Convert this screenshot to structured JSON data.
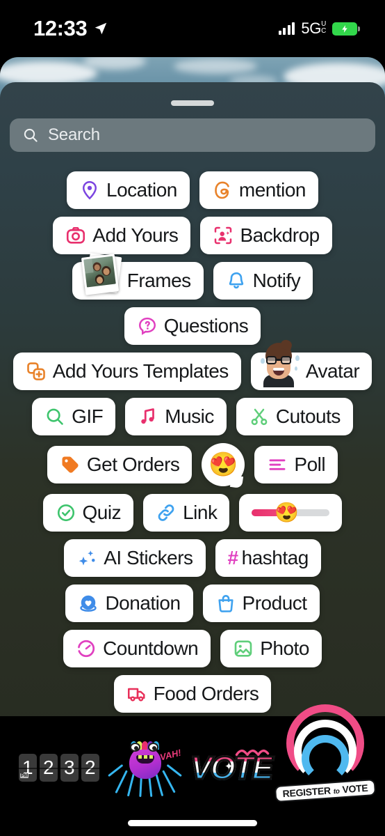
{
  "status_bar": {
    "time": "12:33",
    "location_icon": "location-arrow-icon",
    "signal_icon": "cellular-bars-icon",
    "network": "5G",
    "network_sup_top": "U",
    "network_sup_bottom": "C",
    "battery_icon": "battery-charging-icon",
    "battery_color": "#32d74b"
  },
  "sheet": {
    "grabber": "drag-handle",
    "search": {
      "placeholder": "Search",
      "icon": "search-icon"
    }
  },
  "stickers": {
    "rows": [
      [
        {
          "id": "location",
          "label": "Location",
          "icon": "map-pin-icon",
          "color": "#7b44e0"
        },
        {
          "id": "mention",
          "label": "mention",
          "icon": "threads-at-icon",
          "color": "#e8822a"
        }
      ],
      [
        {
          "id": "add-yours",
          "label": "Add Yours",
          "icon": "camera-icon",
          "color": "#e8306d"
        },
        {
          "id": "backdrop",
          "label": "Backdrop",
          "icon": "person-sparkle-icon",
          "color": "#e8306d"
        }
      ],
      [
        {
          "id": "frames",
          "label": "Frames",
          "icon": "polaroid-photo-icon",
          "color": "#ffffff"
        },
        {
          "id": "notify",
          "label": "Notify",
          "icon": "bell-icon",
          "color": "#3fa2ef"
        }
      ],
      [
        {
          "id": "questions",
          "label": "Questions",
          "icon": "question-bubble-icon",
          "color": "#e040c0"
        }
      ],
      [
        {
          "id": "add-yours-templates",
          "label": "Add Yours Templates",
          "icon": "layered-plus-icon",
          "color": "#e8822a"
        },
        {
          "id": "avatar",
          "label": "Avatar",
          "icon": "memoji-avatar-icon",
          "color": "#e8b089"
        }
      ],
      [
        {
          "id": "gif",
          "label": "GIF",
          "icon": "magnifier-icon",
          "color": "#3ec46d"
        },
        {
          "id": "music",
          "label": "Music",
          "icon": "music-note-icon",
          "color": "#e8306d"
        },
        {
          "id": "cutouts",
          "label": "Cutouts",
          "icon": "scissors-icon",
          "color": "#5fce7a"
        }
      ],
      [
        {
          "id": "get-orders",
          "label": "Get Orders",
          "icon": "price-tag-icon",
          "color": "#f07a22"
        },
        {
          "id": "emoji-reaction",
          "label": "",
          "icon": "emoji-bubble-icon",
          "emoji": "😍",
          "color": "#ffffff"
        },
        {
          "id": "poll",
          "label": "Poll",
          "icon": "poll-bars-icon",
          "color": "#e040c0"
        }
      ],
      [
        {
          "id": "quiz",
          "label": "Quiz",
          "icon": "check-circle-icon",
          "color": "#3ec46d"
        },
        {
          "id": "link",
          "label": "Link",
          "icon": "chain-link-icon",
          "color": "#3fa2ef"
        },
        {
          "id": "emoji-slider",
          "label": "",
          "icon": "emoji-slider-icon",
          "emoji": "😍",
          "color": "#e8306d",
          "fill_percent": 45
        }
      ],
      [
        {
          "id": "ai-stickers",
          "label": "AI Stickers",
          "icon": "sparkle-icon",
          "color": "#3f8ce8"
        },
        {
          "id": "hashtag",
          "label": "hashtag",
          "icon": "hash-icon",
          "color": "#e040c0",
          "prefix": "#"
        }
      ],
      [
        {
          "id": "donation",
          "label": "Donation",
          "icon": "heart-coin-icon",
          "color": "#3f8ce8"
        },
        {
          "id": "product",
          "label": "Product",
          "icon": "shopping-bag-icon",
          "color": "#3fa2ef"
        }
      ],
      [
        {
          "id": "countdown",
          "label": "Countdown",
          "icon": "timer-icon",
          "color": "#e040c0"
        },
        {
          "id": "photo",
          "label": "Photo",
          "icon": "image-icon",
          "color": "#5fce7a"
        }
      ],
      [
        {
          "id": "food-orders",
          "label": "Food Orders",
          "icon": "delivery-truck-icon",
          "color": "#e8305a"
        }
      ]
    ]
  },
  "bottom_strip": {
    "items": [
      {
        "id": "time-flip-clock",
        "name": "flip-clock-sticker",
        "meridiem": "PM",
        "digits": [
          "1",
          "2",
          "3",
          "2"
        ]
      },
      {
        "id": "spider-monster",
        "name": "spider-monster-sticker",
        "text": "VAH!"
      },
      {
        "id": "vote",
        "name": "vote-sticker",
        "text": "VOTE"
      },
      {
        "id": "register-to-vote",
        "name": "register-to-vote-sticker",
        "text_main": "REGISTER",
        "text_small": "to",
        "text_end": "VOTE"
      }
    ]
  },
  "home_indicator": "home-indicator"
}
